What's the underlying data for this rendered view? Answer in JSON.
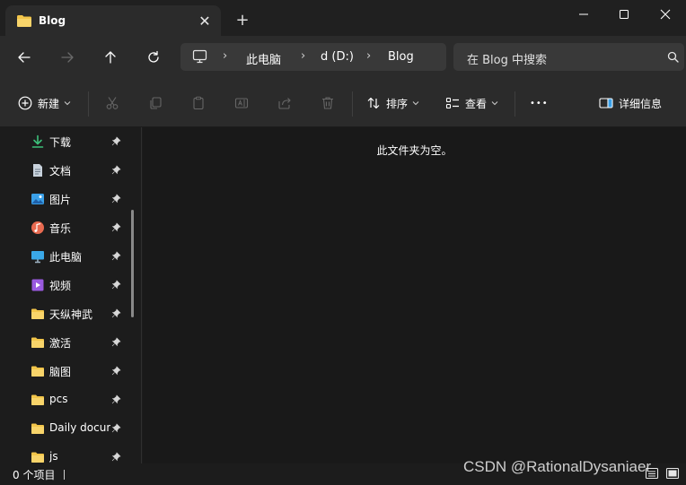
{
  "window": {
    "tab_title": "Blog",
    "tab_close": "✕",
    "new_tab": "+"
  },
  "address": {
    "crumbs": [
      "此电脑",
      "d (D:)",
      "Blog"
    ],
    "separator": "›"
  },
  "search": {
    "placeholder": "在 Blog 中搜索"
  },
  "toolbar": {
    "new_label": "新建",
    "sort_label": "排序",
    "view_label": "查看",
    "more_label": "•••",
    "details_label": "详细信息"
  },
  "sidebar": {
    "items": [
      {
        "label": "下载",
        "icon": "download-icon",
        "color": "#3cc07a"
      },
      {
        "label": "文档",
        "icon": "document-icon",
        "color": "#c8d2dc"
      },
      {
        "label": "图片",
        "icon": "picture-icon",
        "color": "#3aa0e8"
      },
      {
        "label": "音乐",
        "icon": "music-icon",
        "color": "#e86a50"
      },
      {
        "label": "此电脑",
        "icon": "computer-icon",
        "color": "#3aa8e8"
      },
      {
        "label": "视频",
        "icon": "video-icon",
        "color": "#9a5ae0"
      },
      {
        "label": "天纵神武",
        "icon": "folder-icon",
        "color": "#f2c54a"
      },
      {
        "label": "激活",
        "icon": "folder-icon",
        "color": "#f2c54a"
      },
      {
        "label": "脑图",
        "icon": "folder-icon",
        "color": "#f2c54a"
      },
      {
        "label": "pcs",
        "icon": "folder-icon",
        "color": "#f2c54a"
      },
      {
        "label": "Daily document",
        "icon": "folder-icon",
        "color": "#f2c54a"
      },
      {
        "label": "js",
        "icon": "folder-icon",
        "color": "#f2c54a"
      }
    ]
  },
  "main": {
    "empty_message": "此文件夹为空。"
  },
  "status": {
    "item_count": "0 个项目",
    "watermark": "CSDN @RationalDysaniaer"
  },
  "colors": {
    "accent": "#3aa0e8",
    "folder": "#f2c54a",
    "background": "#191919"
  }
}
